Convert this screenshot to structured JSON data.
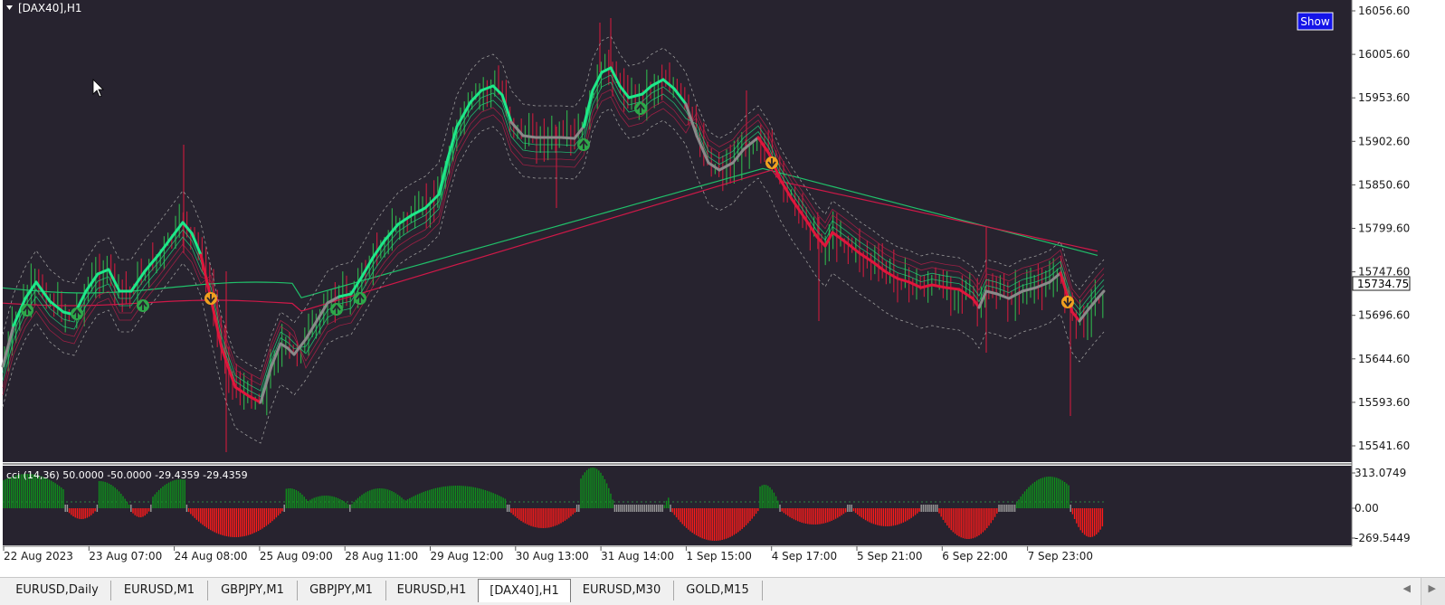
{
  "chart": {
    "symbol_label": "[DAX40],H1",
    "show_button": "Show",
    "price_labels": [
      "16056.60",
      "16005.60",
      "15953.60",
      "15902.60",
      "15850.60",
      "15799.60",
      "15747.60",
      "15696.60",
      "15644.60",
      "15593.60",
      "15541.60"
    ],
    "current_price": "15734.75",
    "time_labels": [
      "22 Aug 2023",
      "23 Aug 07:00",
      "24 Aug 08:00",
      "25 Aug 09:00",
      "28 Aug 11:00",
      "29 Aug 12:00",
      "30 Aug 13:00",
      "31 Aug 14:00",
      "1 Sep 15:00",
      "4 Sep 17:00",
      "5 Sep 21:00",
      "6 Sep 22:00",
      "7 Sep 23:00"
    ],
    "colors": {
      "background": "#27232f",
      "bull_candle": "#2ea84a",
      "bear_candle": "#c01c3c",
      "trend_up": "#1ee88a",
      "trend_down": "#e0163c",
      "trend_flat": "#8a8a8a",
      "show_button_bg": "#1414e8"
    }
  },
  "indicator": {
    "label": "cci  (14,36) 50.0000 -50.0000 -29.4359 -29.4359",
    "scale_labels": [
      "313.0749",
      "0.00",
      "-269.5449"
    ],
    "colors": {
      "positive": "#0f8f1c",
      "negative": "#ff1a1a",
      "neutral": "#9a9a9a"
    }
  },
  "tabs": [
    {
      "label": "EURUSD,Daily"
    },
    {
      "label": "EURUSD,M1"
    },
    {
      "label": "GBPJPY,M1"
    },
    {
      "label": "GBPJPY,M1"
    },
    {
      "label": "EURUSD,H1"
    },
    {
      "label": "[DAX40],H1",
      "active": true
    },
    {
      "label": "EURUSD,M30"
    },
    {
      "label": "GOLD,M15"
    }
  ],
  "nav": {
    "prev": "◀",
    "next": "▶"
  }
}
